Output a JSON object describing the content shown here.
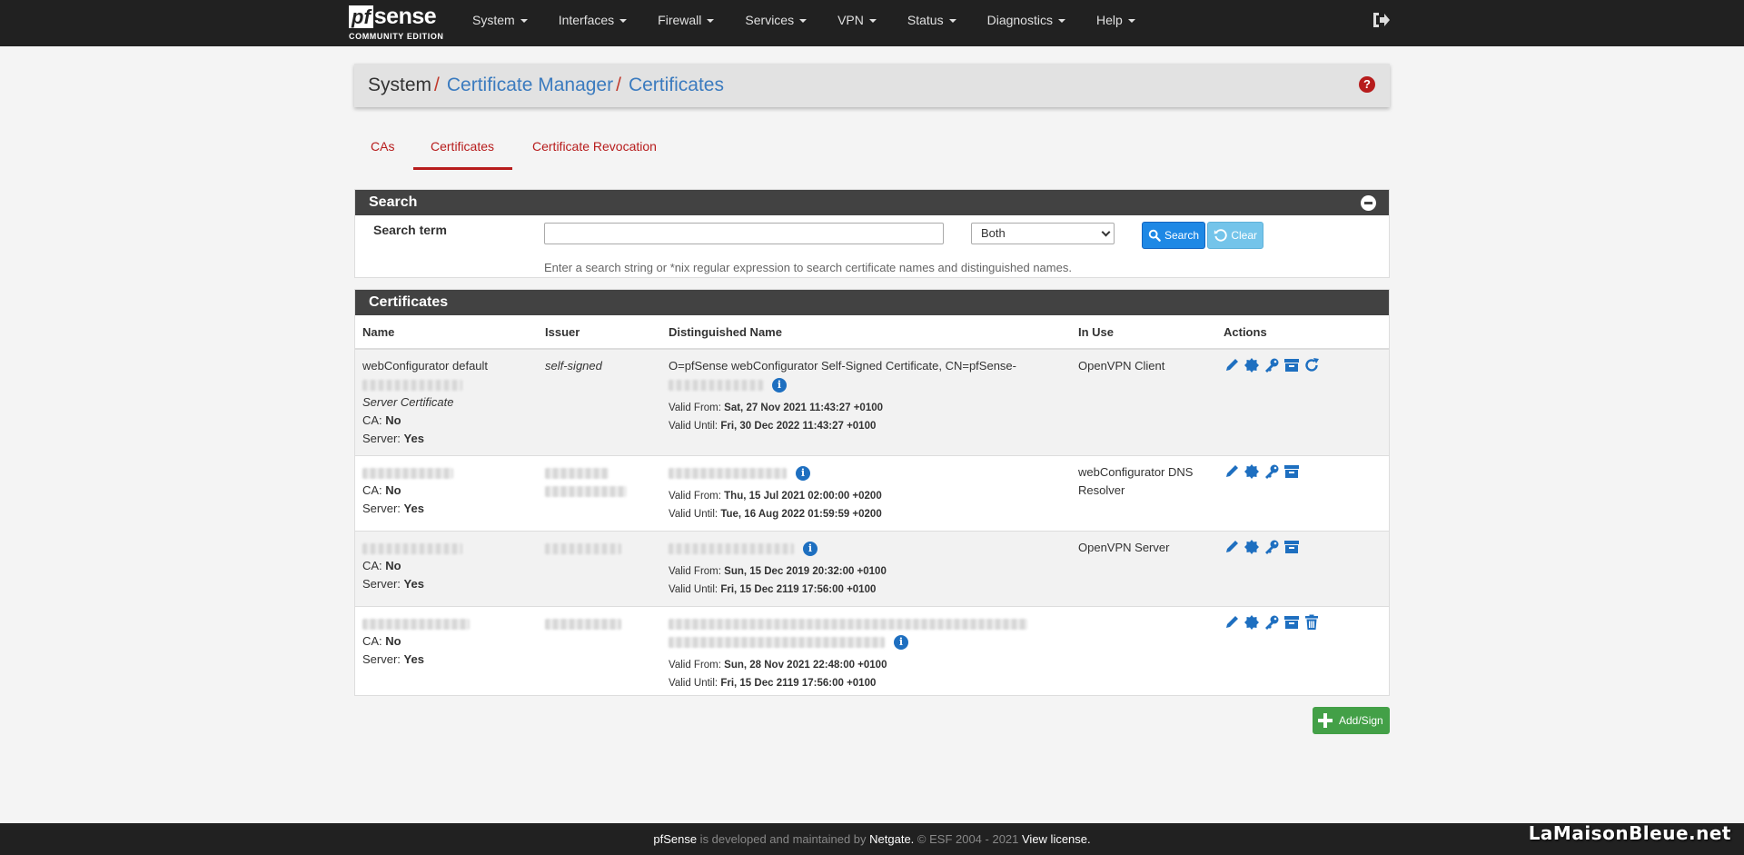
{
  "navbar": {
    "logo_pf": "pf",
    "logo_sense": "sense",
    "logo_sub": "COMMUNITY EDITION",
    "menu": [
      {
        "label": "System"
      },
      {
        "label": "Interfaces"
      },
      {
        "label": "Firewall"
      },
      {
        "label": "Services"
      },
      {
        "label": "VPN"
      },
      {
        "label": "Status"
      },
      {
        "label": "Diagnostics"
      },
      {
        "label": "Help"
      }
    ],
    "logout_icon": "sign-out-icon"
  },
  "breadcrumb": {
    "root": "System",
    "sep1": "/",
    "middle": "Certificate Manager",
    "sep2": "/",
    "current": "Certificates",
    "help_icon": "?"
  },
  "tabs": [
    {
      "label": "CAs",
      "active": false
    },
    {
      "label": "Certificates",
      "active": true
    },
    {
      "label": "Certificate Revocation",
      "active": false
    }
  ],
  "search": {
    "title": "Search",
    "label": "Search term",
    "input_value": "",
    "select_value": "Both",
    "search_button": "Search",
    "clear_button": "Clear",
    "help_text": "Enter a search string or *nix regular expression to search certificate names and distinguished names."
  },
  "certificates": {
    "title": "Certificates",
    "columns": [
      "Name",
      "Issuer",
      "Distinguished Name",
      "In Use",
      "Actions"
    ],
    "ca_label": "CA:",
    "server_label": "Server:",
    "valid_from_label": "Valid From:",
    "valid_until_label": "Valid Until:",
    "rows": [
      {
        "name": "webConfigurator default",
        "name_sub": "Server Certificate",
        "issuer": "self-signed",
        "dn": "O=pfSense webConfigurator Self-Signed Certificate, CN=pfSense-",
        "valid_from": "Sat, 27 Nov 2021 11:43:27 +0100",
        "valid_until": "Fri, 30 Dec 2022 11:43:27 +0100",
        "in_use": "OpenVPN Client",
        "ca": "No",
        "server": "Yes",
        "actions": [
          "edit-icon",
          "certificate-icon",
          "key-icon",
          "archive-icon",
          "renew-icon"
        ]
      },
      {
        "valid_from": "Thu, 15 Jul 2021 02:00:00 +0200",
        "valid_until": "Tue, 16 Aug 2022 01:59:59 +0200",
        "in_use": "webConfigurator DNS Resolver",
        "ca": "No",
        "server": "Yes",
        "actions": [
          "edit-icon",
          "certificate-icon",
          "key-icon",
          "archive-icon"
        ]
      },
      {
        "valid_from": "Sun, 15 Dec 2019 20:32:00 +0100",
        "valid_until": "Fri, 15 Dec 2119 17:56:00 +0100",
        "in_use": "OpenVPN Server",
        "ca": "No",
        "server": "Yes",
        "actions": [
          "edit-icon",
          "certificate-icon",
          "key-icon",
          "archive-icon"
        ]
      },
      {
        "valid_from": "Sun, 28 Nov 2021 22:48:00 +0100",
        "valid_until": "Fri, 15 Dec 2119 17:56:00 +0100",
        "in_use": "",
        "ca": "No",
        "server": "Yes",
        "actions": [
          "edit-icon",
          "certificate-icon",
          "key-icon",
          "archive-icon",
          "trash-icon"
        ]
      }
    ]
  },
  "add_button": "Add/Sign",
  "footer": {
    "brand": "pfSense",
    "text1": " is developed and maintained by ",
    "company": "Netgate.",
    "text2": " © ESF 2004 - 2021 ",
    "license": "View license."
  },
  "watermark": "LaMaisonBleue.net",
  "colors": {
    "navbar": "#212121",
    "accent_red": "#b71c1c",
    "link_blue": "#3b7bbf",
    "action_blue": "#1e6fc0",
    "add_green": "#43a047"
  }
}
